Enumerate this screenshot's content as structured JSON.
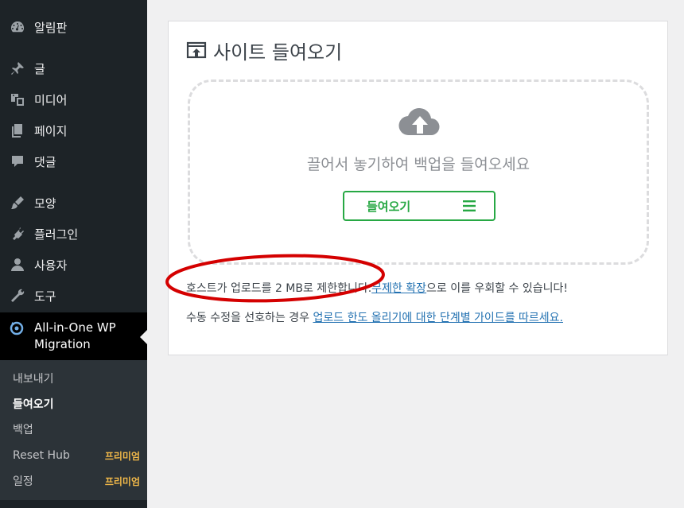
{
  "sidebar": {
    "items": [
      {
        "label": "알림판",
        "icon": "dashboard-icon"
      },
      {
        "label": "글",
        "icon": "pin-icon"
      },
      {
        "label": "미디어",
        "icon": "media-icon"
      },
      {
        "label": "페이지",
        "icon": "pages-icon"
      },
      {
        "label": "댓글",
        "icon": "comment-icon"
      },
      {
        "label": "모양",
        "icon": "appearance-brush-icon"
      },
      {
        "label": "플러그인",
        "icon": "plugin-icon"
      },
      {
        "label": "사용자",
        "icon": "user-icon"
      },
      {
        "label": "도구",
        "icon": "wrench-icon"
      }
    ],
    "active": {
      "label_line1": "All-in-One WP",
      "label_line2": "Migration",
      "icon": "ai1wm-logo-icon"
    },
    "submenu": [
      {
        "label": "내보내기",
        "badge": ""
      },
      {
        "label": "들여오기",
        "badge": ""
      },
      {
        "label": "백업",
        "badge": ""
      },
      {
        "label": "Reset Hub",
        "badge": "프리미엄"
      },
      {
        "label": "일정",
        "badge": "프리미엄"
      }
    ]
  },
  "card": {
    "title": "사이트 들여오기",
    "drop_text": "끌어서 놓기하여 백업을 들여오세요",
    "import_button": "들여오기",
    "note1_prefix": "호스트가 업로드를 2 MB로 제한합니다.",
    "note1_link": "무제한 확장",
    "note1_suffix": "으로 이를 우회할 수 있습니다!",
    "note2_prefix": "수동 수정을 선호하는 경우 ",
    "note2_link": "업로드 한도 올리기에 대한 단계별 가이드를 따르세요."
  },
  "colors": {
    "sidebar_bg": "#1d2327",
    "accent_green": "#27a844",
    "link_blue": "#2271b1",
    "premium_yellow": "#f0b849",
    "annotation_red": "#d40000"
  }
}
